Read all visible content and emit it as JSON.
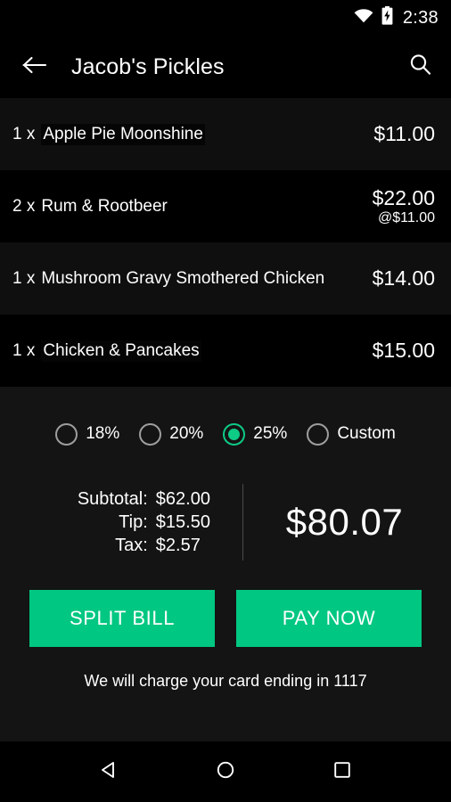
{
  "status_bar": {
    "time": "2:38",
    "wifi_icon": "wifi-icon",
    "battery_icon": "battery-charging-icon"
  },
  "app_bar": {
    "back_icon": "back-arrow-icon",
    "title": "Jacob's Pickles",
    "search_icon": "search-icon"
  },
  "order": {
    "items": [
      {
        "qty": "1 x",
        "name": "Apple Pie Moonshine",
        "price": "$11.00",
        "unit_price": ""
      },
      {
        "qty": "2 x",
        "name": "Rum & Rootbeer",
        "price": "$22.00",
        "unit_price": "@$11.00"
      },
      {
        "qty": "1 x",
        "name": "Mushroom Gravy Smothered Chicken",
        "price": "$14.00",
        "unit_price": ""
      },
      {
        "qty": "1 x",
        "name": "Chicken & Pancakes",
        "price": "$15.00",
        "unit_price": ""
      }
    ]
  },
  "tip": {
    "options": [
      {
        "label": "18%",
        "selected": false
      },
      {
        "label": "20%",
        "selected": false
      },
      {
        "label": "25%",
        "selected": true
      },
      {
        "label": "Custom",
        "selected": false
      }
    ]
  },
  "totals": {
    "lines": [
      {
        "label": "Subtotal:",
        "value": "$62.00"
      },
      {
        "label": "Tip:",
        "value": "$15.50"
      },
      {
        "label": "Tax:",
        "value": "$2.57"
      }
    ],
    "grand_total": "$80.07"
  },
  "actions": {
    "split_bill_label": "SPLIT BILL",
    "pay_now_label": "PAY NOW",
    "charge_note": "We will charge your card ending in 1117"
  },
  "nav_bar": {
    "back_icon": "nav-back-triangle-icon",
    "home_icon": "nav-home-circle-icon",
    "recents_icon": "nav-recents-square-icon"
  },
  "colors": {
    "accent_green": "#00C781",
    "radio_green": "#0ECB86",
    "background": "#000000",
    "panel": "#141414",
    "row_alt": "#0f0f0f"
  }
}
